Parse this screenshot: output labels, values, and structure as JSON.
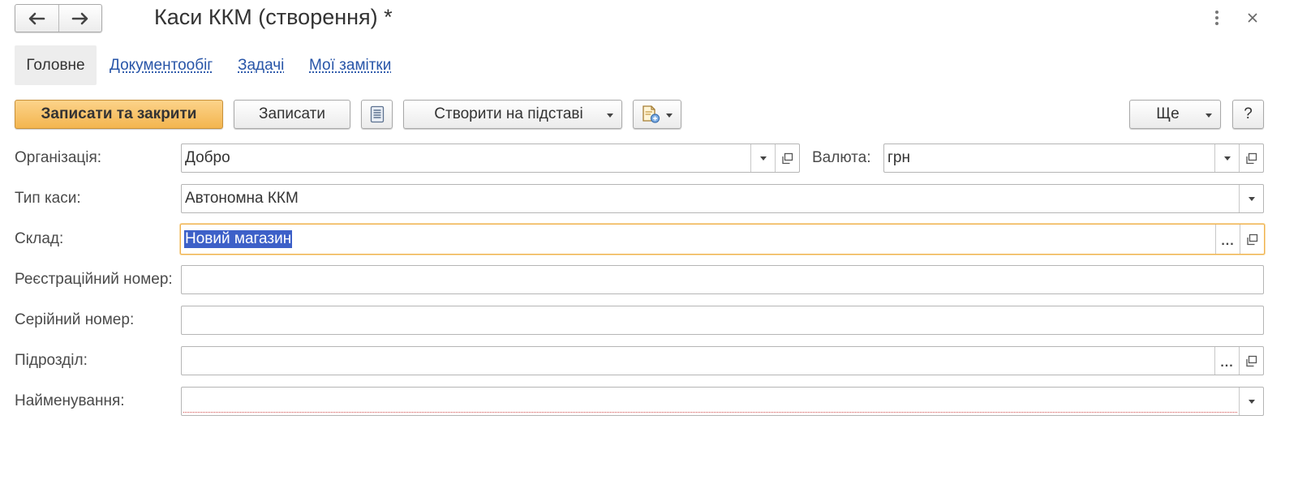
{
  "window": {
    "title": "Каси ККМ (створення) *",
    "back_icon": "arrow-left-icon",
    "forward_icon": "arrow-right-icon",
    "more_icon": "more-vertical-icon",
    "close_icon": "close-icon"
  },
  "tabs": [
    {
      "label": "Головне",
      "active": true
    },
    {
      "label": "Документообіг",
      "active": false
    },
    {
      "label": "Задачі",
      "active": false
    },
    {
      "label": "Мої замітки",
      "active": false
    }
  ],
  "toolbar": {
    "save_close_label": "Записати та закрити",
    "save_label": "Записати",
    "journal_icon": "document-list-icon",
    "create_based_label": "Створити на підставі",
    "print_icon": "report-icon",
    "more_label": "Ще",
    "help_label": "?"
  },
  "form": {
    "organization": {
      "label": "Організація:",
      "value": "Добро"
    },
    "currency": {
      "label": "Валюта:",
      "value": "грн"
    },
    "cash_type": {
      "label": "Тип каси:",
      "value": "Автономна ККМ"
    },
    "warehouse": {
      "label": "Склад:",
      "value": "Новий магазин"
    },
    "reg_number": {
      "label": "Реєстраційний номер:",
      "value": ""
    },
    "serial_number": {
      "label": "Серійний номер:",
      "value": ""
    },
    "department": {
      "label": "Підрозділ:",
      "value": ""
    },
    "name": {
      "label": "Найменування:",
      "value": ""
    }
  },
  "colors": {
    "accent": "#f3b54f",
    "link": "#2855a8",
    "selection": "#3d60c8",
    "focus_border": "#f0b24d"
  }
}
